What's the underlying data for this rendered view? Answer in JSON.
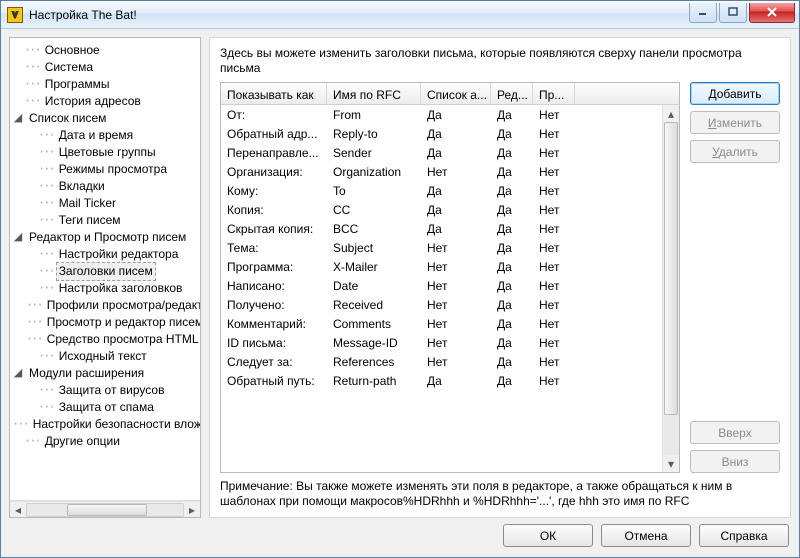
{
  "window": {
    "title": "Настройка The Bat!"
  },
  "tree": [
    {
      "label": "Основное"
    },
    {
      "label": "Система"
    },
    {
      "label": "Программы"
    },
    {
      "label": "История адресов"
    },
    {
      "label": "Список писем",
      "expanded": true,
      "children": [
        {
          "label": "Дата и время"
        },
        {
          "label": "Цветовые группы"
        },
        {
          "label": "Режимы просмотра"
        },
        {
          "label": "Вкладки"
        },
        {
          "label": "Mail Ticker"
        },
        {
          "label": "Теги писем"
        }
      ]
    },
    {
      "label": "Редактор и Просмотр писем",
      "expanded": true,
      "children": [
        {
          "label": "Настройки редактора"
        },
        {
          "label": "Заголовки писем",
          "selected": true
        },
        {
          "label": "Настройка заголовков"
        },
        {
          "label": "Профили просмотра/редактирования"
        },
        {
          "label": "Просмотр и редактор писем"
        },
        {
          "label": "Средство просмотра HTML"
        },
        {
          "label": "Исходный текст"
        }
      ]
    },
    {
      "label": "Модули расширения",
      "expanded": true,
      "children": [
        {
          "label": "Защита от вирусов"
        },
        {
          "label": "Защита от спама"
        }
      ]
    },
    {
      "label": "Настройки безопасности вложений"
    },
    {
      "label": "Другие опции",
      "expanded": false
    }
  ],
  "right": {
    "description": "Здесь вы можете изменить заголовки письма, которые появляются сверху панели просмотра письма",
    "columns": [
      "Показывать как",
      "Имя по RFC",
      "Список а...",
      "Ред...",
      "Пр..."
    ],
    "rows": [
      [
        "От:",
        "From",
        "Да",
        "Да",
        "Нет"
      ],
      [
        "Обратный адр...",
        "Reply-to",
        "Да",
        "Да",
        "Нет"
      ],
      [
        "Перенаправле...",
        "Sender",
        "Да",
        "Да",
        "Нет"
      ],
      [
        "Организация:",
        "Organization",
        "Нет",
        "Да",
        "Нет"
      ],
      [
        "Кому:",
        "To",
        "Да",
        "Да",
        "Нет"
      ],
      [
        "Копия:",
        "CC",
        "Да",
        "Да",
        "Нет"
      ],
      [
        "Скрытая копия:",
        "BCC",
        "Да",
        "Да",
        "Нет"
      ],
      [
        "Тема:",
        "Subject",
        "Нет",
        "Да",
        "Нет"
      ],
      [
        "Программа:",
        "X-Mailer",
        "Нет",
        "Да",
        "Нет"
      ],
      [
        "Написано:",
        "Date",
        "Нет",
        "Да",
        "Нет"
      ],
      [
        "Получено:",
        "Received",
        "Нет",
        "Да",
        "Нет"
      ],
      [
        "Комментарий:",
        "Comments",
        "Нет",
        "Да",
        "Нет"
      ],
      [
        "ID письма:",
        "Message-ID",
        "Нет",
        "Да",
        "Нет"
      ],
      [
        "Следует за:",
        "References",
        "Нет",
        "Да",
        "Нет"
      ],
      [
        "Обратный путь:",
        "Return-path",
        "Да",
        "Да",
        "Нет"
      ]
    ],
    "note": "Примечание: Вы также можете изменять эти поля в редакторе, а также обращаться к ним в шаблонах при помощи макросов%HDRhhh и %HDRhhh='...', где hhh это имя по RFC",
    "buttons": {
      "add": "Добавить",
      "add_mn": "Д",
      "edit": "Изменить",
      "edit_mn": "И",
      "delete": "Удалить",
      "delete_mn": "У",
      "up": "Вверх",
      "down": "Вниз"
    }
  },
  "dialog": {
    "ok": "ОК",
    "cancel": "Отмена",
    "help": "Справка"
  }
}
